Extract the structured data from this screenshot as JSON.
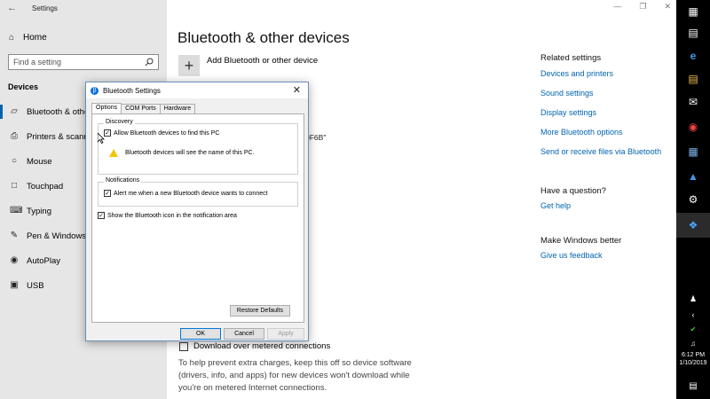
{
  "settings": {
    "app_title": "Settings",
    "home_label": "Home",
    "search_placeholder": "Find a setting",
    "section": "Devices",
    "sidebar_items": [
      {
        "label": "Bluetooth & other devices",
        "icon": "bluetooth-icon"
      },
      {
        "label": "Printers & scanners",
        "icon": "printer-icon"
      },
      {
        "label": "Mouse",
        "icon": "mouse-icon"
      },
      {
        "label": "Touchpad",
        "icon": "touchpad-icon"
      },
      {
        "label": "Typing",
        "icon": "keyboard-icon"
      },
      {
        "label": "Pen & Windows Ink",
        "icon": "pen-icon"
      },
      {
        "label": "AutoPlay",
        "icon": "autoplay-icon"
      },
      {
        "label": "USB",
        "icon": "usb-icon"
      }
    ],
    "page_title": "Bluetooth & other devices",
    "add_device_label": "Add Bluetooth or other device",
    "fragment_1": "0F6B\"",
    "fragment_2": "r",
    "metered_label": "Download over metered connections",
    "metered_description": "To help prevent extra charges, keep this off so device software (drivers, info, and apps) for new devices won't download while you're on metered Internet connections.",
    "related_heading": "Related settings",
    "related_links": [
      "Devices and printers",
      "Sound settings",
      "Display settings",
      "More Bluetooth options",
      "Send or receive files via Bluetooth"
    ],
    "question_heading": "Have a question?",
    "question_link": "Get help",
    "better_heading": "Make Windows better",
    "better_link": "Give us feedback"
  },
  "dialog": {
    "title": "Bluetooth Settings",
    "tabs": [
      "Options",
      "COM Ports",
      "Hardware"
    ],
    "discovery_group": "Discovery",
    "allow_find_label": "Allow Bluetooth devices to find this PC",
    "warning_text": "Bluetooth devices will see the name of this PC.",
    "notifications_group": "Notifications",
    "alert_label": "Alert me when a new Bluetooth device wants to connect",
    "show_icon_label": "Show the Bluetooth icon in the notification area",
    "restore_label": "Restore Defaults",
    "ok_label": "OK",
    "cancel_label": "Cancel",
    "apply_label": "Apply",
    "checkboxes": {
      "allow_find": true,
      "alert": true,
      "show_icon": true
    }
  },
  "taskbar": {
    "time": "6:12 PM",
    "date": "1/10/2019"
  },
  "colors": {
    "accent": "#0063b1",
    "sidebar_bg": "#e6e6e6",
    "taskbar_bg": "#000000"
  }
}
